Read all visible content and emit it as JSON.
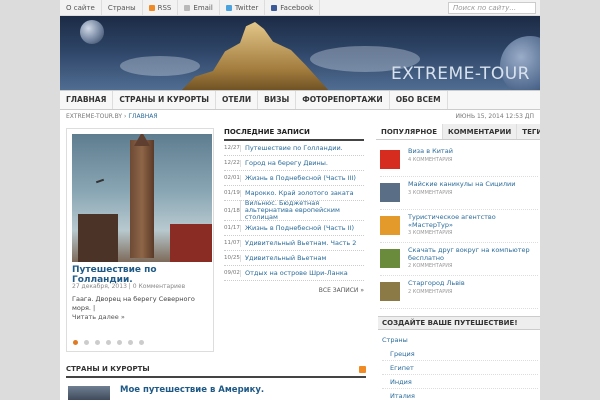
{
  "topbar": {
    "about": "О сайте",
    "countries": "Страны",
    "rss": "RSS",
    "email": "Email",
    "twitter": "Twitter",
    "facebook": "Facebook",
    "search_placeholder": "Поиск по сайту..."
  },
  "banner": {
    "logo": "EXTREME-TOUR"
  },
  "nav": [
    "ГЛАВНАЯ",
    "СТРАНЫ И КУРОРТЫ",
    "ОТЕЛИ",
    "ВИЗЫ",
    "ФОТОРЕПОРТАЖИ",
    "ОБО ВСЕМ"
  ],
  "breadcrumb": {
    "site": "EXTREME-TOUR.BY",
    "current": "ГЛАВНАЯ",
    "date": "ИЮНЬ 15, 2014 12:53 ДП"
  },
  "slider": {
    "title": "Путешествие по Голландии.",
    "meta": "27 декабря, 2013 | 0 Комментариев",
    "excerpt": "Гаага. Дворец на берегу Северного моря. |",
    "more": "Читать далее »"
  },
  "recent": {
    "heading": "ПОСЛЕДНИЕ ЗАПИСИ",
    "items": [
      {
        "date": "12/27",
        "title": "Путешествие по Голландии."
      },
      {
        "date": "12/22",
        "title": "Город на берегу Двины."
      },
      {
        "date": "02/01",
        "title": "Жизнь в Поднебесной (Часть III)"
      },
      {
        "date": "01/19",
        "title": "Марокко. Край золотого заката"
      },
      {
        "date": "01/18",
        "title": "Вильнюс. Бюджетная альтернатива европейским столицам"
      },
      {
        "date": "01/17",
        "title": "Жизнь в Поднебесной (Часть II)"
      },
      {
        "date": "11/07",
        "title": "Удивительный Вьетнам. Часть 2"
      },
      {
        "date": "10/25",
        "title": "Удивительный Вьетнам"
      },
      {
        "date": "09/02",
        "title": "Отдых на острове Шри-Ланка"
      }
    ],
    "all": "ВСЕ ЗАПИСИ »"
  },
  "tabs": [
    "ПОПУЛЯРНОЕ",
    "КОММЕНТАРИИ",
    "ТЕГИ"
  ],
  "popular": [
    {
      "title": "Виза в Китай",
      "count": "4 КОММЕНТАРИЯ",
      "color": "#d62b1f"
    },
    {
      "title": "Майские каникулы на Сицилии",
      "count": "3 КОММЕНТАРИЯ",
      "color": "#5a6e86"
    },
    {
      "title": "Туристическое агентство «МастерТур»",
      "count": "3 КОММЕНТАРИЯ",
      "color": "#e39a2b"
    },
    {
      "title": "Скачать друг вокруг на компьютер бесплатно",
      "count": "2 КОММЕНТАРИЯ",
      "color": "#6a8a3c"
    },
    {
      "title": "Старгород Львів",
      "count": "2 КОММЕНТАРИЯ",
      "color": "#8b7a45"
    }
  ],
  "create": {
    "heading": "СОЗДАЙТЕ ВАШЕ ПУТЕШЕСТВИЕ!"
  },
  "categories": {
    "root": "Страны",
    "items": [
      "Греция",
      "Египет",
      "Индия",
      "Италия"
    ]
  },
  "countries_section": {
    "heading": "СТРАНЫ И КУРОРТЫ",
    "story_title": "Мое путешествие в Америку."
  }
}
